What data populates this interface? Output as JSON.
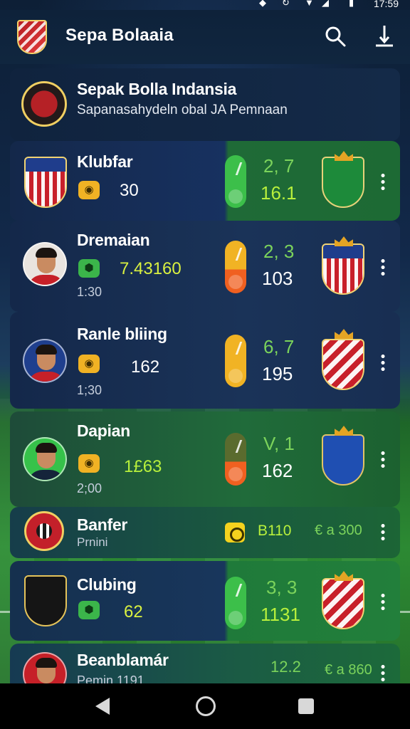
{
  "status_bar": {
    "time": "17:59"
  },
  "app_bar": {
    "title": "Sepa Bolaaia",
    "search_icon": "search-icon",
    "download_icon": "download-icon"
  },
  "header_card": {
    "title": "Sepak Bolla Indansia",
    "subtitle": "Sapanasahydeln obal JA Pemnaan"
  },
  "rows": [
    {
      "name": "Klubfar",
      "stat": "30",
      "time": "",
      "score_top": "2, 7",
      "score_bottom": "16.1"
    },
    {
      "name": "Dremaian",
      "stat": "7.43160",
      "time": "1:30",
      "score_top": "2, 3",
      "score_bottom": "103"
    },
    {
      "name": "Ranle bliing",
      "stat": "162",
      "time": "1;30",
      "score_top": "6, 7",
      "score_bottom": "195"
    },
    {
      "name": "Dapian",
      "stat": "1£63",
      "time": "2;00",
      "score_top": "V, 1",
      "score_bottom": "162"
    },
    {
      "name": "Banfer",
      "sub": "Prnini",
      "value_a": "B110",
      "value_b": "€ a 300"
    },
    {
      "name": "Clubing",
      "stat": "62",
      "score_top": "3, 3",
      "score_bottom": "1131"
    },
    {
      "name": "Beanblamár",
      "sub": "Pemin 1191",
      "value_a": "12.2",
      "value_b": "€ a 860"
    }
  ],
  "colors": {
    "accent_green": "#3cbf4a",
    "accent_yellow": "#f1b324",
    "accent_orange": "#f06020",
    "card_navy": "#1a3358",
    "card_green": "#206b3a"
  }
}
